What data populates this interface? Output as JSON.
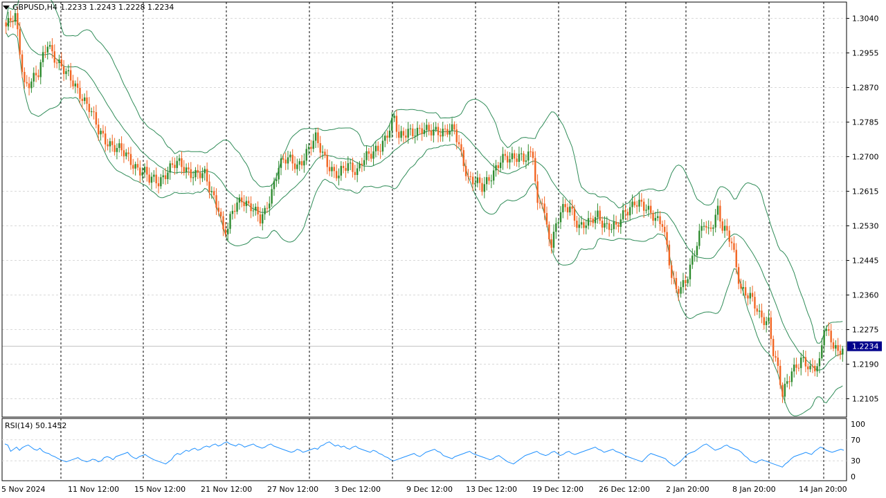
{
  "header": {
    "symbol_timeframe": "GBPUSD,H4",
    "ohlc": "1.2233 1.2243 1.2228 1.2234"
  },
  "price_axis": {
    "labels": [
      "1.3040",
      "1.2955",
      "1.2870",
      "1.2785",
      "1.2700",
      "1.2615",
      "1.2530",
      "1.2445",
      "1.2360",
      "1.2275",
      "1.2190",
      "1.2105"
    ],
    "current_price": "1.2234"
  },
  "rsi": {
    "label": "RSI(14) 50.1452",
    "levels": [
      "100",
      "70",
      "30",
      "0"
    ],
    "values": [
      62,
      60,
      48,
      52,
      56,
      50,
      55,
      58,
      60,
      56,
      52,
      50,
      54,
      48,
      45,
      44,
      40,
      38,
      35,
      32,
      30,
      28,
      30,
      32,
      34,
      36,
      32,
      30,
      28,
      30,
      33,
      32,
      28,
      30,
      36,
      38,
      36,
      32,
      38,
      40,
      42,
      44,
      46,
      40,
      36,
      34,
      38,
      40,
      42,
      38,
      35,
      32,
      30,
      28,
      26,
      24,
      28,
      32,
      40,
      44,
      42,
      46,
      50,
      48,
      52,
      54,
      50,
      52,
      56,
      58,
      56,
      60,
      62,
      58,
      60,
      64,
      66,
      62,
      60,
      58,
      62,
      60,
      56,
      58,
      60,
      62,
      58,
      56,
      54,
      56,
      60,
      62,
      58,
      56,
      54,
      52,
      50,
      48,
      46,
      48,
      52,
      50,
      46,
      48,
      50,
      52,
      54,
      52,
      58,
      60,
      64,
      66,
      62,
      58,
      60,
      56,
      58,
      54,
      52,
      56,
      58,
      54,
      52,
      50,
      48,
      46,
      50,
      48,
      44,
      42,
      38,
      36,
      32,
      30,
      32,
      34,
      36,
      38,
      40,
      42,
      44,
      40,
      38,
      42,
      46,
      48,
      50,
      52,
      48,
      46,
      40,
      38,
      36,
      34,
      38,
      40,
      42,
      44,
      46,
      48,
      44,
      42,
      40,
      38,
      36,
      34,
      32,
      34,
      38,
      40,
      36,
      32,
      28,
      26,
      24,
      28,
      32,
      36,
      40,
      42,
      44,
      46,
      48,
      44,
      42,
      40,
      42,
      46,
      48,
      44,
      40,
      42,
      46,
      48,
      44,
      42,
      44,
      46,
      48,
      50,
      52,
      54,
      56,
      52,
      50,
      46,
      48,
      50,
      52,
      48,
      46,
      44,
      40,
      38,
      36,
      34,
      32,
      30,
      28,
      34,
      40,
      44,
      42,
      40,
      38,
      36,
      34,
      28,
      24,
      20,
      24,
      28,
      34,
      40,
      44,
      46,
      48,
      52,
      56,
      60,
      62,
      58,
      54,
      50,
      52,
      54,
      58,
      60,
      56,
      54,
      52,
      50,
      46,
      40,
      36,
      30,
      28,
      26,
      30,
      32,
      30,
      28,
      26,
      24,
      22,
      20,
      18,
      24,
      28,
      34,
      38,
      40,
      42,
      44,
      46,
      44,
      42,
      48,
      52,
      56,
      54,
      50,
      48,
      46,
      48,
      50,
      52,
      50
    ],
    "colors": {
      "line": "#1e90ff"
    }
  },
  "x_axis": {
    "labels": [
      "5 Nov 2024",
      "11 Nov 12:00",
      "15 Nov 12:00",
      "21 Nov 12:00",
      "27 Nov 12:00",
      "3 Dec 12:00",
      "9 Dec 12:00",
      "13 Dec 12:00",
      "19 Dec 12:00",
      "26 Dec 12:00",
      "2 Jan 20:00",
      "8 Jan 20:00",
      "14 Jan 20:00"
    ]
  },
  "colors": {
    "bull": "#2e8b2e",
    "bear": "#f26522",
    "bands": "#2e8b57",
    "grid": "#d8d8d8",
    "price_tag_bg": "#00008b"
  },
  "chart_data": {
    "type": "candlestick",
    "symbol": "GBPUSD",
    "timeframe": "H4",
    "ylim": [
      1.206,
      1.308
    ],
    "anchors": [
      [
        0,
        1.302
      ],
      [
        4,
        1.304
      ],
      [
        8,
        1.288
      ],
      [
        14,
        1.29
      ],
      [
        18,
        1.298
      ],
      [
        22,
        1.294
      ],
      [
        26,
        1.29
      ],
      [
        32,
        1.286
      ],
      [
        36,
        1.282
      ],
      [
        40,
        1.276
      ],
      [
        44,
        1.274
      ],
      [
        48,
        1.272
      ],
      [
        52,
        1.27
      ],
      [
        56,
        1.268
      ],
      [
        60,
        1.266
      ],
      [
        62,
        1.264
      ],
      [
        66,
        1.264
      ],
      [
        70,
        1.267
      ],
      [
        74,
        1.268
      ],
      [
        78,
        1.267
      ],
      [
        82,
        1.266
      ],
      [
        86,
        1.265
      ],
      [
        88,
        1.262
      ],
      [
        92,
        1.258
      ],
      [
        94,
        1.252
      ],
      [
        96,
        1.252
      ],
      [
        98,
        1.256
      ],
      [
        102,
        1.26
      ],
      [
        106,
        1.258
      ],
      [
        110,
        1.254
      ],
      [
        112,
        1.256
      ],
      [
        114,
        1.26
      ],
      [
        118,
        1.268
      ],
      [
        122,
        1.269
      ],
      [
        126,
        1.268
      ],
      [
        130,
        1.271
      ],
      [
        134,
        1.274
      ],
      [
        138,
        1.27
      ],
      [
        142,
        1.266
      ],
      [
        144,
        1.265
      ],
      [
        148,
        1.268
      ],
      [
        152,
        1.267
      ],
      [
        154,
        1.269
      ],
      [
        158,
        1.27
      ],
      [
        162,
        1.273
      ],
      [
        166,
        1.277
      ],
      [
        168,
        1.279
      ],
      [
        170,
        1.274
      ],
      [
        174,
        1.277
      ],
      [
        178,
        1.276
      ],
      [
        182,
        1.276
      ],
      [
        186,
        1.277
      ],
      [
        190,
        1.276
      ],
      [
        194,
        1.276
      ],
      [
        196,
        1.273
      ],
      [
        200,
        1.265
      ],
      [
        204,
        1.263
      ],
      [
        206,
        1.262
      ],
      [
        210,
        1.266
      ],
      [
        214,
        1.269
      ],
      [
        218,
        1.269
      ],
      [
        222,
        1.271
      ],
      [
        224,
        1.27
      ],
      [
        228,
        1.27
      ],
      [
        230,
        1.257
      ],
      [
        232,
        1.26
      ],
      [
        234,
        1.253
      ],
      [
        236,
        1.249
      ],
      [
        240,
        1.256
      ],
      [
        244,
        1.258
      ],
      [
        248,
        1.253
      ],
      [
        252,
        1.253
      ],
      [
        256,
        1.256
      ],
      [
        260,
        1.253
      ],
      [
        264,
        1.252
      ],
      [
        268,
        1.257
      ],
      [
        272,
        1.259
      ],
      [
        276,
        1.257
      ],
      [
        280,
        1.256
      ],
      [
        284,
        1.254
      ],
      [
        288,
        1.24
      ],
      [
        290,
        1.237
      ],
      [
        294,
        1.24
      ],
      [
        298,
        1.246
      ],
      [
        302,
        1.254
      ],
      [
        304,
        1.252
      ],
      [
        308,
        1.257
      ],
      [
        310,
        1.252
      ],
      [
        314,
        1.249
      ],
      [
        318,
        1.238
      ],
      [
        322,
        1.235
      ],
      [
        326,
        1.231
      ],
      [
        330,
        1.23
      ],
      [
        332,
        1.222
      ],
      [
        334,
        1.217
      ],
      [
        336,
        1.211
      ],
      [
        340,
        1.218
      ],
      [
        344,
        1.22
      ],
      [
        348,
        1.217
      ],
      [
        352,
        1.22
      ],
      [
        354,
        1.229
      ],
      [
        358,
        1.223
      ],
      [
        360,
        1.221
      ],
      [
        362,
        1.2234
      ]
    ],
    "total_bars": 363
  }
}
